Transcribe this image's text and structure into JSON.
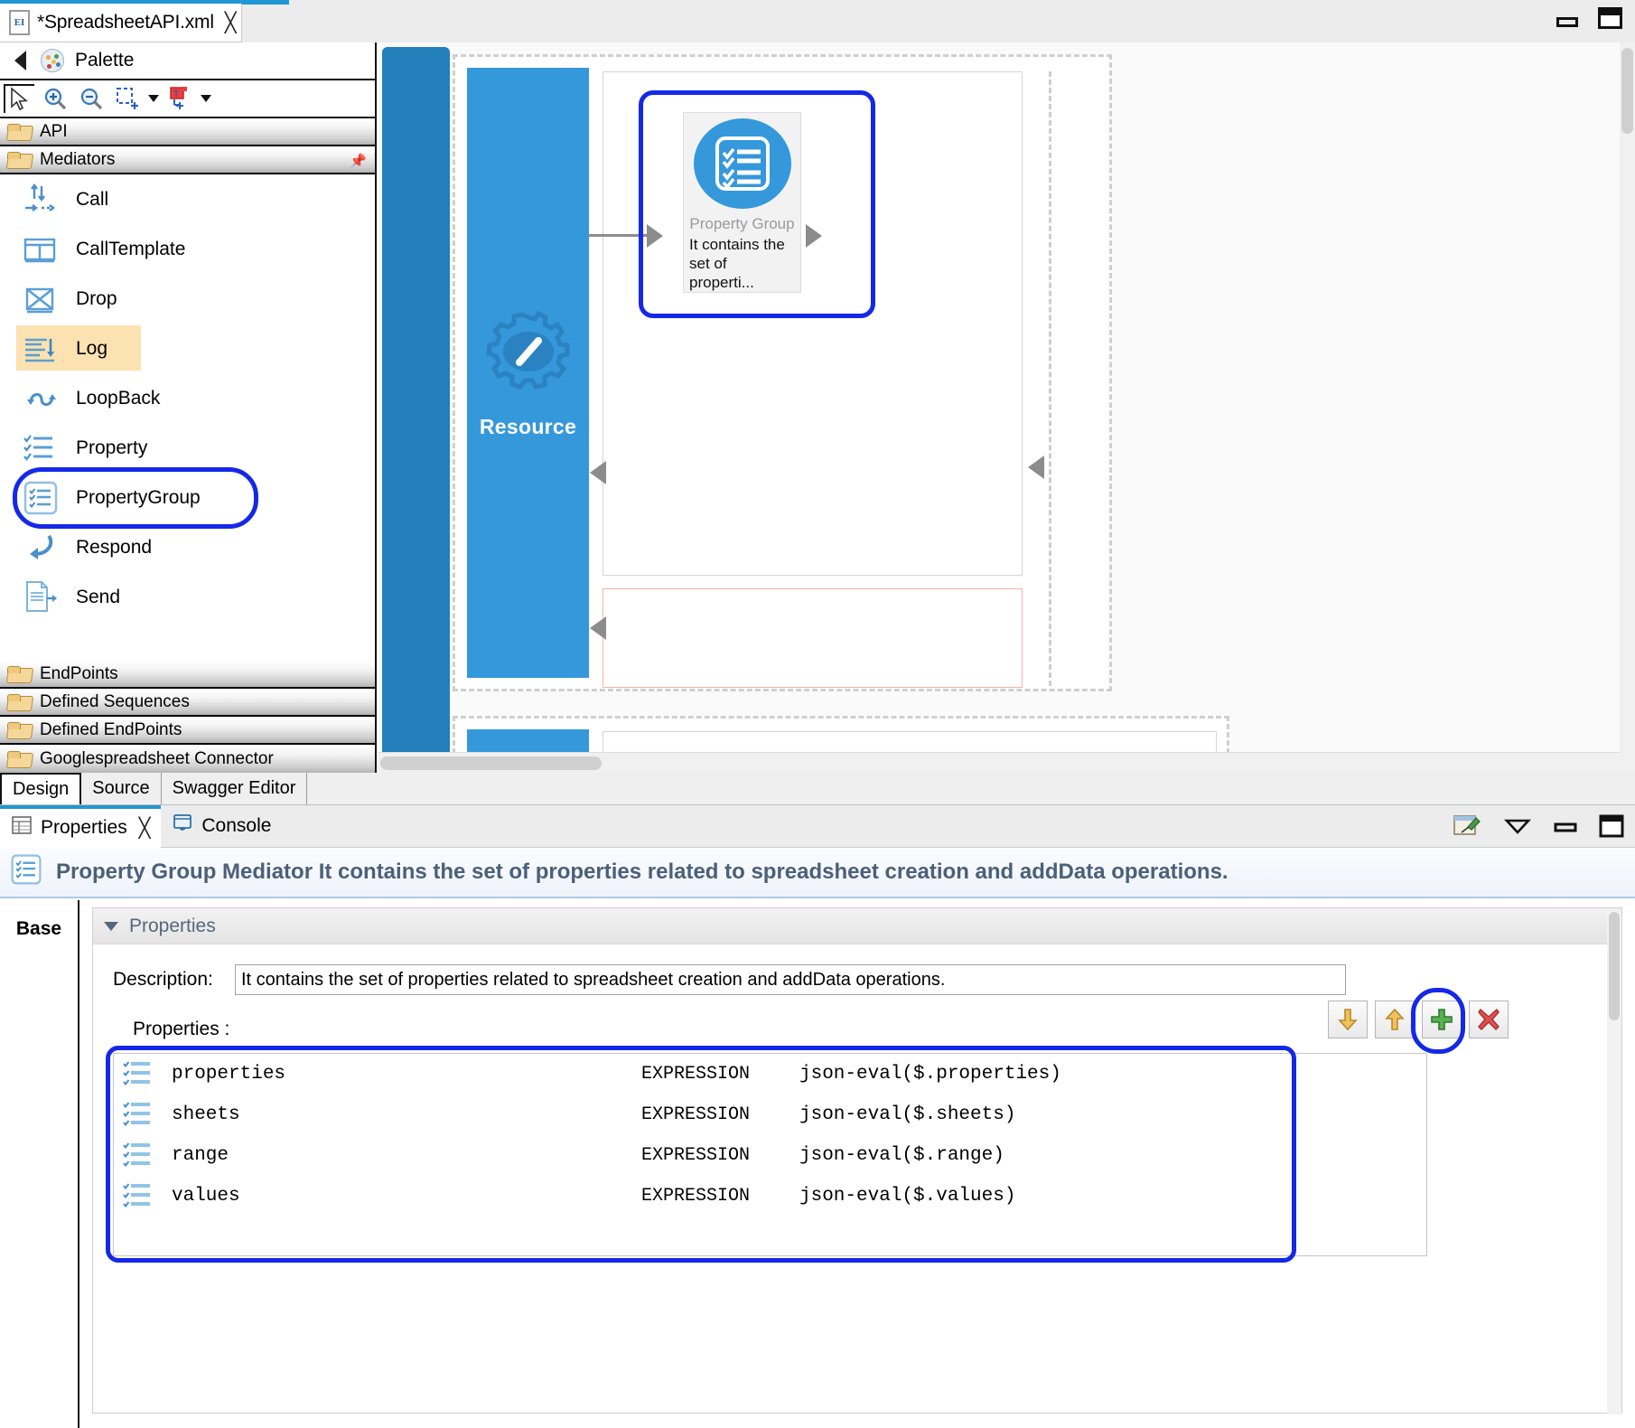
{
  "window": {
    "minimize_icon": "minimize-icon",
    "maximize_icon": "maximize-icon"
  },
  "editor_tab": {
    "file_icon": "xml-file-icon",
    "icon_text": "EI",
    "title": "*SpreadsheetAPI.xml",
    "close_icon": "close-icon"
  },
  "palette": {
    "collapse_icon": "collapse-left-icon",
    "palette_icon": "palette-icon",
    "title": "Palette",
    "toolbar": [
      {
        "name": "select-tool",
        "glyph": "arrow"
      },
      {
        "name": "zoom-in-tool",
        "glyph": "zoom-in"
      },
      {
        "name": "zoom-out-tool",
        "glyph": "zoom-out"
      },
      {
        "name": "marquee-tool",
        "glyph": "marquee"
      },
      {
        "name": "marquee-dropdown",
        "glyph": "caret"
      },
      {
        "name": "connection-tool",
        "glyph": "connection"
      },
      {
        "name": "connection-dropdown",
        "glyph": "caret"
      }
    ],
    "categories_top": [
      {
        "label": "API",
        "icon": "folder-icon"
      },
      {
        "label": "Mediators",
        "icon": "folder-icon",
        "pinned": true,
        "pin_icon": "pin-icon"
      }
    ],
    "mediators": [
      {
        "label": "Call",
        "icon": "call-mediator-icon",
        "highlighted": false,
        "selected": false
      },
      {
        "label": "CallTemplate",
        "icon": "calltemplate-mediator-icon",
        "highlighted": false,
        "selected": false
      },
      {
        "label": "Drop",
        "icon": "drop-mediator-icon",
        "highlighted": false,
        "selected": false
      },
      {
        "label": "Log",
        "icon": "log-mediator-icon",
        "highlighted": true,
        "selected": false
      },
      {
        "label": "LoopBack",
        "icon": "loopback-mediator-icon",
        "highlighted": false,
        "selected": false
      },
      {
        "label": "Property",
        "icon": "property-mediator-icon",
        "highlighted": false,
        "selected": false
      },
      {
        "label": "PropertyGroup",
        "icon": "propertygroup-mediator-icon",
        "highlighted": false,
        "selected": true
      },
      {
        "label": "Respond",
        "icon": "respond-mediator-icon",
        "highlighted": false,
        "selected": false
      },
      {
        "label": "Send",
        "icon": "send-mediator-icon",
        "highlighted": false,
        "selected": false
      }
    ],
    "scroll_down_icon": "scroll-down-icon",
    "categories_bottom": [
      {
        "label": "EndPoints",
        "icon": "folder-icon"
      },
      {
        "label": "Defined Sequences",
        "icon": "folder-icon"
      },
      {
        "label": "Defined EndPoints",
        "icon": "folder-icon"
      },
      {
        "label": "Googlespreadsheet Connector",
        "icon": "folder-icon"
      }
    ]
  },
  "canvas": {
    "resource_label": "Resource",
    "resource_icon": "gear-slash-icon",
    "node": {
      "icon": "propertygroup-node-icon",
      "title": "Property Group",
      "description": "It contains the\nset of properti...",
      "desc_line1": "It contains the",
      "desc_line2": "set of properti...",
      "selected": true
    },
    "hscrollbar": "horizontal-scrollbar",
    "vscrollbar": "vertical-scrollbar"
  },
  "editor_tabs": {
    "items": [
      {
        "label": "Design",
        "active": true
      },
      {
        "label": "Source",
        "active": false
      },
      {
        "label": "Swagger Editor",
        "active": false
      }
    ]
  },
  "properties_view": {
    "tabs": [
      {
        "label": "Properties",
        "icon": "properties-table-icon",
        "close_icon": "close-icon",
        "active": true
      },
      {
        "label": "Console",
        "icon": "console-icon",
        "active": false
      }
    ],
    "tool_icons": [
      {
        "name": "pin-view-icon"
      },
      {
        "name": "view-menu-icon"
      },
      {
        "name": "minimize-view-icon"
      },
      {
        "name": "maximize-view-icon"
      }
    ],
    "header": {
      "icon": "propertygroup-mediator-icon",
      "title": "Property Group Mediator It contains the set of properties related to spreadsheet creation and addData operations."
    },
    "side_tabs": [
      {
        "label": "Base",
        "active": true
      }
    ],
    "section": {
      "title": "Properties",
      "collapse_icon": "section-caret-icon"
    },
    "description": {
      "label": "Description:",
      "value": "It contains the set of properties related to spreadsheet creation and addData operations.",
      "placeholder": ""
    },
    "properties_label": "Properties :",
    "table": {
      "selected": true,
      "rows": [
        {
          "icon": "property-row-icon",
          "name": "properties",
          "type": "EXPRESSION",
          "value": "json-eval($.properties)"
        },
        {
          "icon": "property-row-icon",
          "name": "sheets",
          "type": "EXPRESSION",
          "value": "json-eval($.sheets)"
        },
        {
          "icon": "property-row-icon",
          "name": "range",
          "type": "EXPRESSION",
          "value": "json-eval($.range)"
        },
        {
          "icon": "property-row-icon",
          "name": "values",
          "type": "EXPRESSION",
          "value": "json-eval($.values)"
        }
      ]
    },
    "table_toolbar": [
      {
        "name": "move-down-button",
        "icon": "down-arrow-icon",
        "color": "#e8b24a"
      },
      {
        "name": "move-up-button",
        "icon": "up-arrow-icon",
        "color": "#e8b24a"
      },
      {
        "name": "add-property-button",
        "icon": "plus-icon",
        "color": "#3e9b46",
        "highlighted": true
      },
      {
        "name": "delete-property-button",
        "icon": "delete-x-icon",
        "color": "#d24a4a"
      }
    ]
  },
  "colors": {
    "accent_blue": "#2196d4",
    "selection_blue": "#1528e8",
    "resource_blue": "#3498db",
    "strip_blue": "#2380bb",
    "highlight_yellow": "#fbe2b0",
    "header_text": "#4b6079",
    "faulty_red": "#f3b3a8"
  }
}
